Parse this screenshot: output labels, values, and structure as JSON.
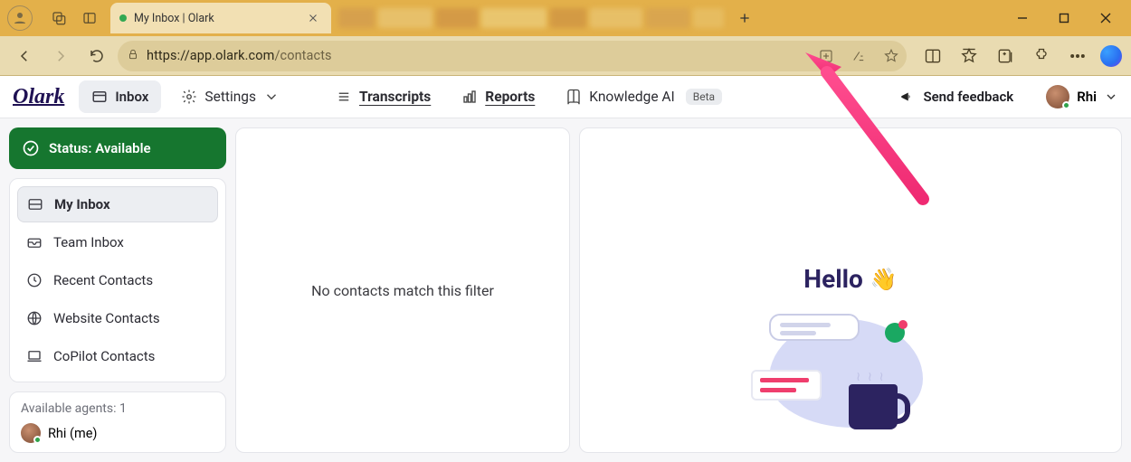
{
  "browser": {
    "tab_title": "My Inbox | Olark",
    "url_host": "https://app.olark.com",
    "url_path": "/contacts"
  },
  "header": {
    "brand": "Olark",
    "inbox_btn": "Inbox",
    "settings": "Settings",
    "transcripts": "Transcripts",
    "reports": "Reports",
    "knowledge": "Knowledge AI",
    "knowledge_badge": "Beta",
    "feedback": "Send feedback",
    "user_name": "Rhi"
  },
  "sidebar": {
    "status": "Status: Available",
    "items": [
      {
        "label": "My Inbox"
      },
      {
        "label": "Team Inbox"
      },
      {
        "label": "Recent Contacts"
      },
      {
        "label": "Website Contacts"
      },
      {
        "label": "CoPilot Contacts"
      }
    ],
    "agents_title": "Available agents: 1",
    "agent_row": "Rhi (me)"
  },
  "list": {
    "empty_text": "No contacts match this filter"
  },
  "detail": {
    "hello": "Hello"
  }
}
